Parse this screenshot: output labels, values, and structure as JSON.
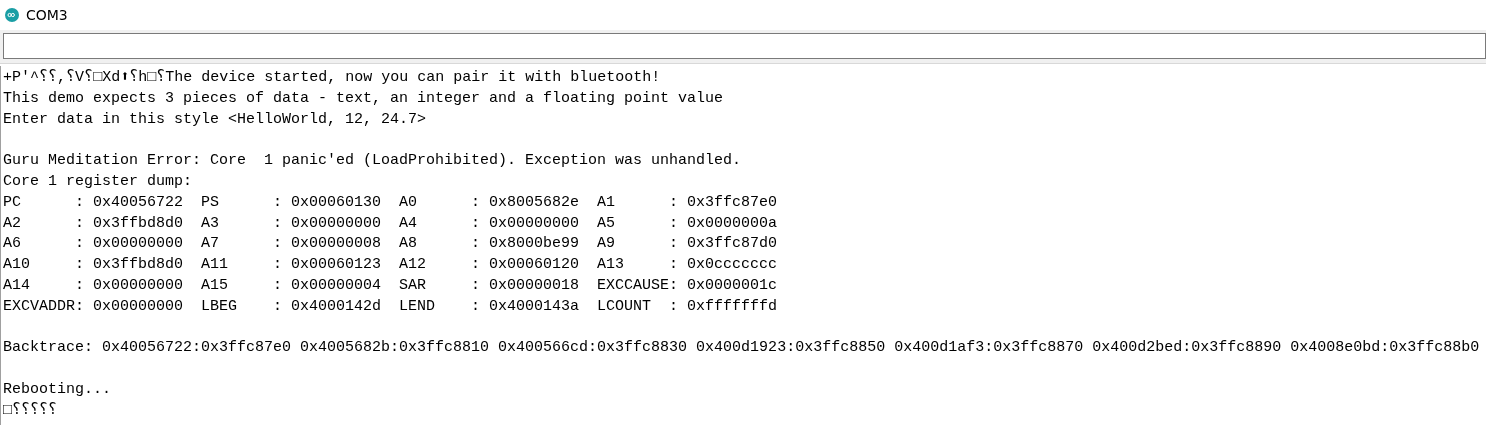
{
  "window": {
    "title": "COM3"
  },
  "output": {
    "blocks": [
      [
        "+P'^⸮⸮,⸮V⸮□Xd⬆⸮h□⸮The device started, now you can pair it with bluetooth!",
        "This demo expects 3 pieces of data - text, an integer and a floating point value",
        "Enter data in this style <HelloWorld, 12, 24.7>"
      ],
      [
        "Guru Meditation Error: Core  1 panic'ed (LoadProhibited). Exception was unhandled.",
        "Core 1 register dump:",
        "PC      : 0x40056722  PS      : 0x00060130  A0      : 0x8005682e  A1      : 0x3ffc87e0",
        "A2      : 0x3ffbd8d0  A3      : 0x00000000  A4      : 0x00000000  A5      : 0x0000000a",
        "A6      : 0x00000000  A7      : 0x00000008  A8      : 0x8000be99  A9      : 0x3ffc87d0",
        "A10     : 0x3ffbd8d0  A11     : 0x00060123  A12     : 0x00060120  A13     : 0x0ccccccc",
        "A14     : 0x00000000  A15     : 0x00000004  SAR     : 0x00000018  EXCCAUSE: 0x0000001c",
        "EXCVADDR: 0x00000000  LBEG    : 0x4000142d  LEND    : 0x4000143a  LCOUNT  : 0xfffffffd"
      ],
      [
        "Backtrace: 0x40056722:0x3ffc87e0 0x4005682b:0x3ffc8810 0x400566cd:0x3ffc8830 0x400d1923:0x3ffc8850 0x400d1af3:0x3ffc8870 0x400d2bed:0x3ffc8890 0x4008e0bd:0x3ffc88b0"
      ],
      [
        "Rebooting...",
        "□⸮⸮⸮⸮⸮"
      ]
    ]
  }
}
